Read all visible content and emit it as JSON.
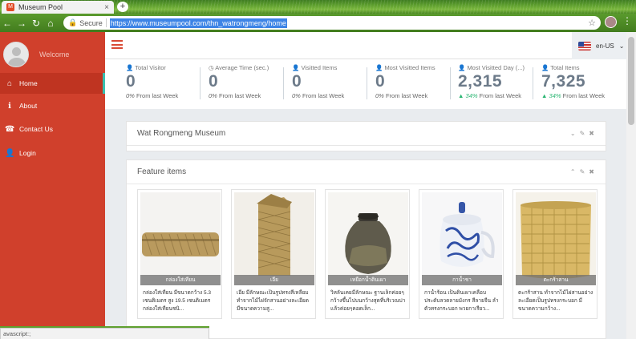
{
  "browser": {
    "tab_title": "Museum Pool",
    "tab_close": "×",
    "new_tab": "+",
    "secure_label": "Secure",
    "url": "https://www.museumpool.com/thn_watrongmeng/home"
  },
  "sidebar": {
    "welcome": "Welcome",
    "items": [
      {
        "label": "Home",
        "icon": "home-icon",
        "glyph": "⌂"
      },
      {
        "label": "About",
        "icon": "info-icon",
        "glyph": "ℹ"
      },
      {
        "label": "Contact Us",
        "icon": "contact-icon",
        "glyph": "☎"
      },
      {
        "label": "Login",
        "icon": "user-icon",
        "glyph": "👤"
      }
    ]
  },
  "header": {
    "language": "en-US",
    "language_caret": "⌄"
  },
  "stats": [
    {
      "label": "Total Visitor",
      "value": "0",
      "pct": "0%",
      "sub": "From last Week",
      "trend": "none"
    },
    {
      "label": "Average Time (sec.)",
      "value": "0",
      "pct": "0%",
      "sub": "From last Week",
      "trend": "none"
    },
    {
      "label": "Visitted Items",
      "value": "0",
      "pct": "0%",
      "sub": "From last Week",
      "trend": "none"
    },
    {
      "label": "Most Visitted Items",
      "value": "0",
      "pct": "0%",
      "sub": "From last Week",
      "trend": "none"
    },
    {
      "label": "Most Visitted Day (...)",
      "value": "2,315",
      "pct": "34%",
      "sub": "From last Week",
      "trend": "up"
    },
    {
      "label": "Total Items",
      "value": "7,325",
      "pct": "34%",
      "sub": "From last Week",
      "trend": "up"
    }
  ],
  "museum_panel": {
    "title": "Wat Rongmeng Museum"
  },
  "feature_panel": {
    "title": "Feature items",
    "items": [
      {
        "caption": "กล่องใส่เทียน",
        "desc": "กล่องใส่เทียน มีขนาดกว้าง 5.3 เซนติเมตร สูง 19.5 เซนติเมตร กล่องใส่เทียนชนิ..."
      },
      {
        "caption": "เอีย",
        "desc": "เอีย มีลักษณะเป็นรูปทรงสี่เหลี่ยม ทำจากไม้ไผ่จักสานอย่างละเอียด มีขนาดความสู..."
      },
      {
        "caption": "เหยือกน้ำดินเผา",
        "desc": "วิหลันเคยมีลักษณะ ฐานเล็กค่อยๆกว้างขึ้นไปบนกว้างสุดที่บริเวณบ่า แล้วค่อยๆคอดเล็ก..."
      },
      {
        "caption": "กาน้ำชา",
        "desc": "กาน้ำร้อน เป็นดินเผาเคลือบ ประดับลวดลายมังกร สีลายจีน ลำตัวทรงกระบอก พวยกาเรียว..."
      },
      {
        "caption": "ตะกร้าสาน",
        "desc": "ตะกร้าสาน ทำจากไม้ไผ่สานอย่างละเอียดเป็นรูปทรงกระบอก มีขนาดความกว้าง..."
      }
    ]
  },
  "status_text": "avascript:;",
  "colors": {
    "sidebar": "#d0402c",
    "accent": "#39c0b0",
    "up": "#2bb673"
  }
}
